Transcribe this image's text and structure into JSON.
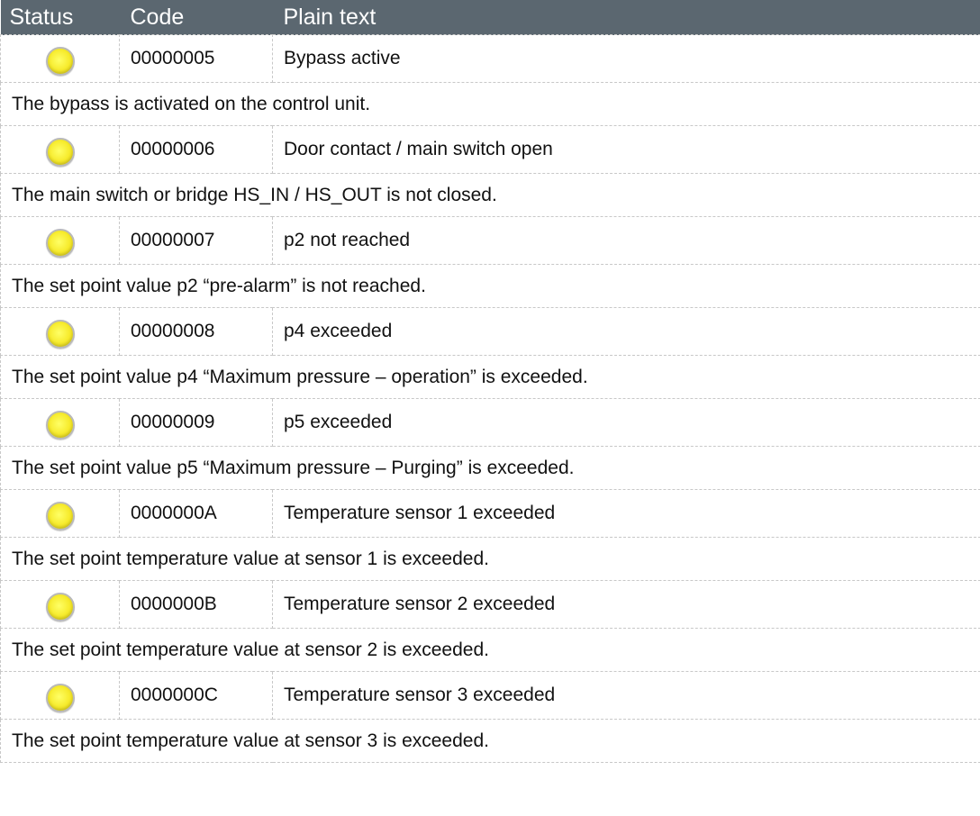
{
  "header": {
    "status": "Status",
    "code": "Code",
    "plain_text": "Plain text"
  },
  "status_color": "#f6ea2a",
  "status_icon": "yellow-status-lamp-icon",
  "rows": [
    {
      "code": "00000005",
      "text": "Bypass active",
      "description": "The bypass is activated on the control unit."
    },
    {
      "code": "00000006",
      "text": "Door contact / main switch open",
      "description": "The main switch or bridge HS_IN / HS_OUT is not closed."
    },
    {
      "code": "00000007",
      "text": "p2 not reached",
      "description": "The set point value p2 “pre-alarm” is not reached."
    },
    {
      "code": "00000008",
      "text": "p4 exceeded",
      "description": "The set point value p4 “Maximum pressure – operation” is exceeded."
    },
    {
      "code": "00000009",
      "text": "p5 exceeded",
      "description": "The set point value p5 “Maximum pressure – Purging” is exceeded."
    },
    {
      "code": "0000000A",
      "text": "Temperature sensor 1 exceeded",
      "description": "The set point temperature value at sensor 1 is exceeded."
    },
    {
      "code": "0000000B",
      "text": "Temperature sensor 2 exceeded",
      "description": "The set point temperature value at sensor 2 is exceeded."
    },
    {
      "code": "0000000C",
      "text": "Temperature sensor 3 exceeded",
      "description": "The set point temperature value at sensor 3 is exceeded."
    }
  ]
}
